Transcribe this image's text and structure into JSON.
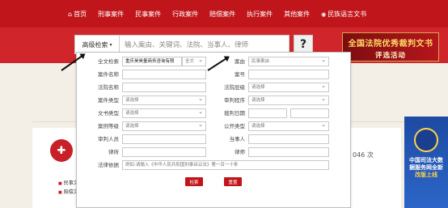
{
  "nav": {
    "items": [
      {
        "label": "首页",
        "icon": "home-icon"
      },
      {
        "label": "刑事案件"
      },
      {
        "label": "民事案件"
      },
      {
        "label": "行政案件"
      },
      {
        "label": "赔偿案件"
      },
      {
        "label": "执行案件"
      },
      {
        "label": "其他案件"
      },
      {
        "label": "民族语言文书",
        "icon": "globe-icon"
      }
    ],
    "bg_color": "#c0161b"
  },
  "search": {
    "type_label": "高级检索",
    "type_caret": "▾",
    "placeholder": "输入案由、关键词、法院、当事人、律师",
    "help_label": "?"
  },
  "banner": {
    "line1": "全国法院优秀裁判文书",
    "line2": "评选活动"
  },
  "advanced": {
    "fulltext_label": "全文检索",
    "fulltext_value": "重庆昊昊量商务咨询有限",
    "fulltext_scope": "全文",
    "cause_label": "案由",
    "cause_value": "民事案由",
    "case_name_label": "案件名称",
    "case_no_label": "案号",
    "court_name_label": "法院名称",
    "court_level_label": "法院层级",
    "court_level_value": "请选择",
    "case_type_label": "案件类型",
    "case_type_value": "请选择",
    "procedure_label": "审判程序",
    "procedure_value": "请选择",
    "doc_type_label": "文书类型",
    "doc_type_value": "请选择",
    "judge_date_label": "裁判日期",
    "case_level_label": "案例等级",
    "case_level_value": "请选择",
    "publish_type_label": "公开类型",
    "publish_type_value": "请选择",
    "judge_label": "审判人员",
    "party_label": "当事人",
    "firm_label": "律所",
    "lawyer_label": "律师",
    "law_basis_label": "法律依据",
    "law_basis_placeholder": "例如:请输入《中华人民共和国刑事诉讼法》第一百一十条",
    "search_btn": "检索",
    "reset_btn": "重置"
  },
  "content": {
    "count_suffix": "046 次",
    "side_a": "民事文",
    "side_b": "赔偿文"
  },
  "promo": {
    "lines": [
      "中国司法大数",
      "据服务网全新",
      "改版上线"
    ]
  }
}
